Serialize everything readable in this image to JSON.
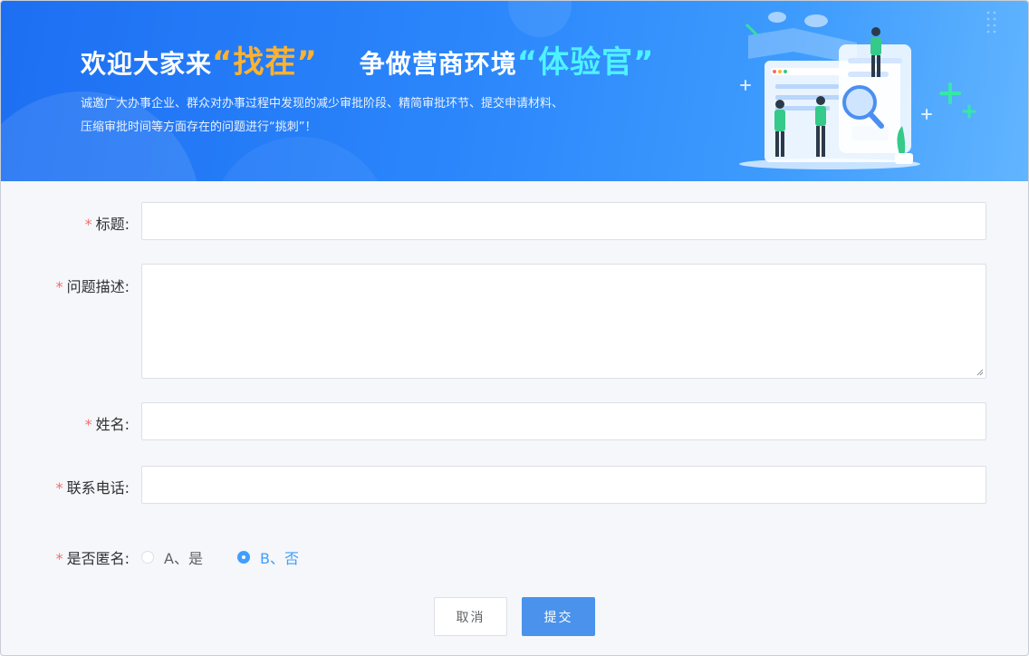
{
  "banner": {
    "title_part1": "欢迎大家来",
    "title_highlight1": "“找茬”",
    "title_part2": "争做营商环境",
    "title_highlight2": "“体验官”",
    "subtitle_line1": "诚邀广大办事企业、群众对办事过程中发现的减少审批阶段、精简审批环节、提交申请材料、",
    "subtitle_line2": "压缩审批时间等方面存在的问题进行“挑刺”！"
  },
  "form": {
    "required_mark": "*",
    "title_label": "标题:",
    "title_value": "",
    "description_label": "问题描述:",
    "description_value": "",
    "name_label": "姓名:",
    "name_value": "",
    "phone_label": "联系电话:",
    "phone_value": "",
    "anonymous_label": "是否匿名:",
    "anonymous_options": [
      {
        "label": "A、是",
        "checked": false
      },
      {
        "label": "B、否",
        "checked": true
      }
    ]
  },
  "buttons": {
    "cancel": "取消",
    "submit": "提交"
  },
  "colors": {
    "accent": "#409eff",
    "required": "#f56c6c",
    "submit_bg": "#4a92ec",
    "banner_blue": "#2b86fb"
  }
}
